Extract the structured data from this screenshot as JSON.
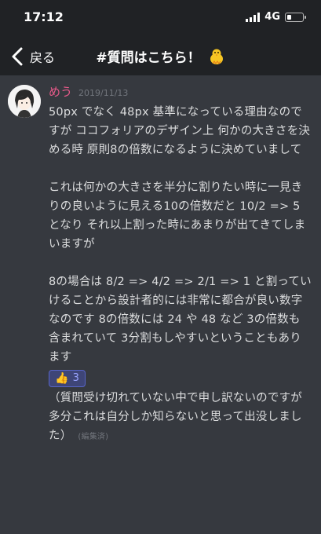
{
  "status": {
    "time": "17:12",
    "network": "4G"
  },
  "header": {
    "back_label": "戻る",
    "channel_name": "#質問はこちら！"
  },
  "message": {
    "username": "めう",
    "date": "2019/11/13",
    "paragraphs": [
      "50px でなく 48px 基準になっている理由なのですが ココフォリアのデザイン上 何かの大きさを決める時 原則8の倍数になるように決めていまして",
      "これは何かの大きさを半分に割りたい時に一見きりの良いように見える10の倍数だと 10/2 => 5 となり それ以上割った時にあまりが出てきてしまいますが",
      "8の場合は 8/2 => 4/2 => 2/1 => 1 と割っていけることから設計者的には非常に都合が良い数字なのです 8の倍数には 24 や 48 など 3の倍数も含まれていて 3分割もしやすいということもあります"
    ],
    "reaction": {
      "emoji": "👍",
      "count": "3"
    },
    "followup": "（質問受け切れていない中で申し訳ないのですが 多分これは自分しか知らないと思って出没しました）",
    "edited_label": "(編集済)"
  }
}
